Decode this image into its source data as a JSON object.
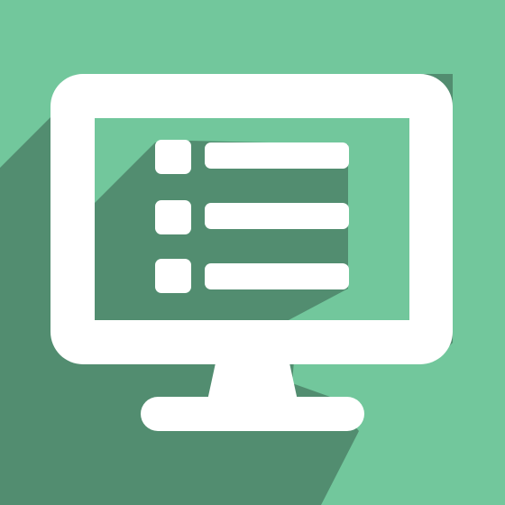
{
  "icon": {
    "name": "monitor-list-icon",
    "shape": "computer monitor showing a list of three items",
    "list_item_count": 3
  },
  "colors": {
    "background": "#72c79c",
    "long_shadow": "#528d70",
    "screen": "#72c79c",
    "foreground": "#ffffff"
  }
}
